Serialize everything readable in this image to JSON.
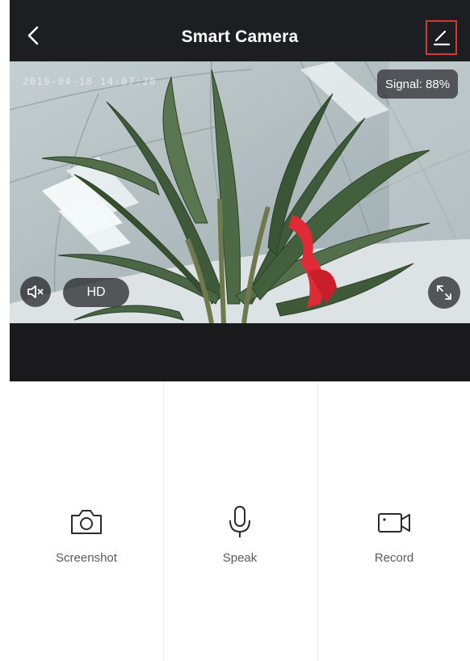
{
  "header": {
    "title": "Smart Camera",
    "back_icon": "chevron-left-icon",
    "edit_icon": "pencil-icon",
    "edit_highlight_color": "#d43a31",
    "background": "#1d1e22"
  },
  "video": {
    "timestamp": "2019-04-18 14:07:20",
    "signal": "Signal: 88%",
    "quality": "HD",
    "mute_icon": "speaker-muted-icon",
    "fullscreen_icon": "fullscreen-icon"
  },
  "controls": [
    {
      "label": "Screenshot",
      "icon": "camera-icon"
    },
    {
      "label": "Speak",
      "icon": "microphone-icon"
    },
    {
      "label": "Record",
      "icon": "video-camera-icon"
    }
  ]
}
